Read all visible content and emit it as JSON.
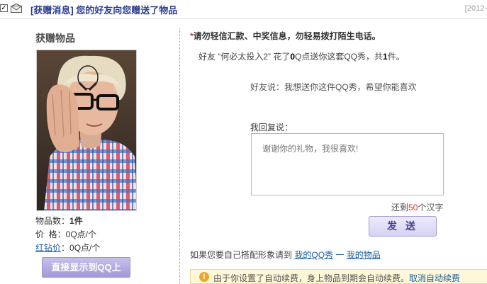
{
  "header": {
    "check_mark": "✓",
    "tag": "[获赠消息]",
    "title": "您的好友向您赠送了物品",
    "date": "[2012-"
  },
  "left": {
    "title": "获赠物品",
    "count_label": "物品数：",
    "count_value": "1件",
    "price_label": "价  格：",
    "price_value": "0Q点/个",
    "diamond_link": "红钻价",
    "diamond_value": "：0Q点/个",
    "show_button": "直接显示到QQ上"
  },
  "right": {
    "warning_star": "*",
    "warning": "请勿轻信汇款、中奖信息，勿轻易拨打陌生电话。",
    "gift_prefix": "好友 “何必太投入2” 花了",
    "gift_qpoints": "0",
    "gift_middle": "Q点送你这套QQ秀，共",
    "gift_count": "1",
    "gift_suffix": "件。",
    "friend_says": "好友说：我想送你这件QQ秀，希望你能喜欢",
    "reply_label": "我回复说：",
    "reply_placeholder": "谢谢你的礼物，我很喜欢!",
    "remain_prefix": "还剩",
    "remain_count": "50",
    "remain_suffix": "个汉字",
    "send_button": "发 送",
    "match_text": "如果您要自己搭配形象请到",
    "link_my_qqshow": "我的QQ秀",
    "link_separator": " 一 ",
    "link_my_items": "我的物品",
    "notice_text": "由于你设置了自动续费，身上物品到期会自动续费。",
    "notice_link": "取消自动续费"
  },
  "colors": {
    "header_title": "#2e3d8f",
    "link": "#1a5fa0",
    "accent_red": "#d33",
    "button_purple": "#a49ad8"
  },
  "icons": {
    "header_checkbox": "check-icon",
    "header_mail": "mail-icon",
    "notice": "warning-icon"
  }
}
